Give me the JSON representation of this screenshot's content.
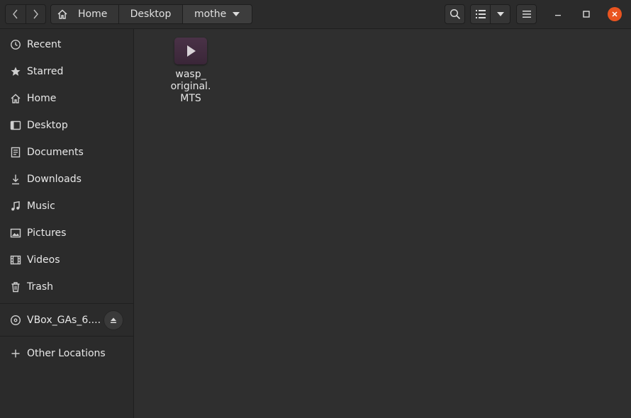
{
  "toolbar": {
    "back_icon": "chevron-left-icon",
    "forward_icon": "chevron-right-icon",
    "breadcrumbs": [
      {
        "label": "Home",
        "icon": "home-icon"
      },
      {
        "label": "Desktop"
      },
      {
        "label": "mothe"
      }
    ],
    "search_icon": "search-icon",
    "view_icon": "list-view-icon",
    "menu_icon": "hamburger-menu-icon",
    "close_color": "#e95420"
  },
  "sidebar": {
    "items": [
      {
        "label": "Recent",
        "icon": "clock-icon"
      },
      {
        "label": "Starred",
        "icon": "star-icon"
      },
      {
        "label": "Home",
        "icon": "home-icon"
      },
      {
        "label": "Desktop",
        "icon": "desktop-icon"
      },
      {
        "label": "Documents",
        "icon": "document-icon"
      },
      {
        "label": "Downloads",
        "icon": "download-icon"
      },
      {
        "label": "Music",
        "icon": "music-icon"
      },
      {
        "label": "Pictures",
        "icon": "picture-icon"
      },
      {
        "label": "Videos",
        "icon": "video-icon"
      },
      {
        "label": "Trash",
        "icon": "trash-icon"
      }
    ],
    "devices": [
      {
        "label": "VBox_GAs_6....",
        "icon": "disc-icon",
        "action_icon": "eject-icon"
      }
    ],
    "other": {
      "label": "Other Locations",
      "icon": "plus-icon"
    }
  },
  "files": [
    {
      "name": "wasp_\noriginal.\nMTS",
      "icon": "video-play-icon"
    }
  ]
}
